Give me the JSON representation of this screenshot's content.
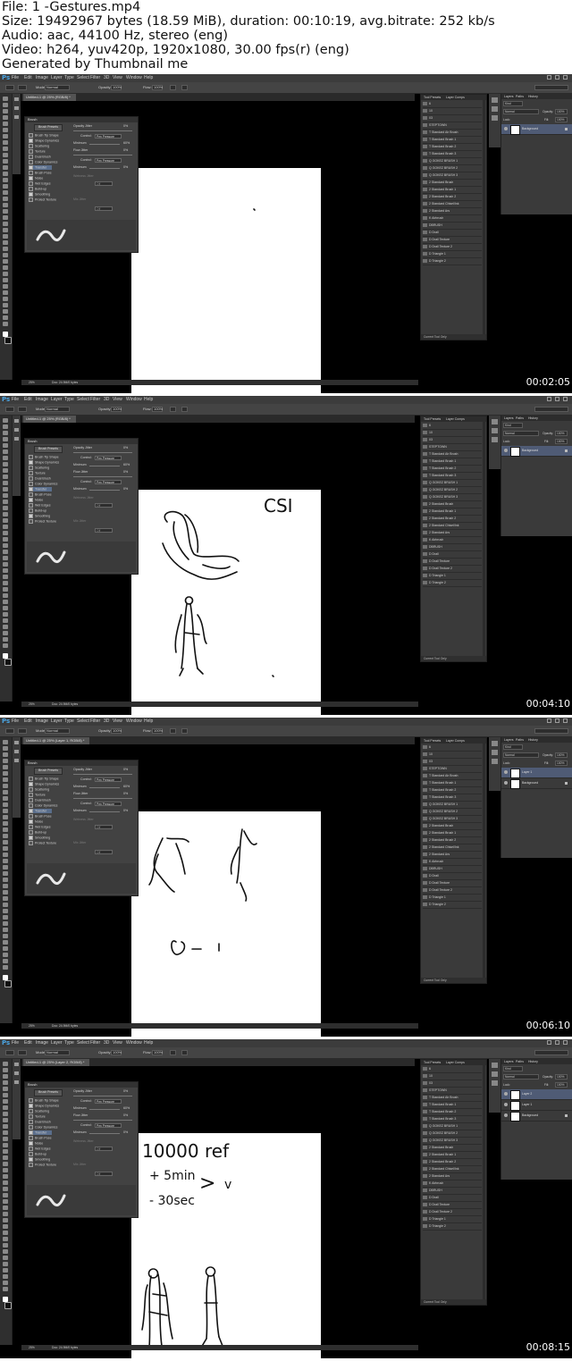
{
  "header": {
    "file_line": "File: 1 -Gestures.mp4",
    "size_line": "Size: 19492967 bytes (18.59 MiB), duration: 00:10:19, avg.bitrate: 252 kb/s",
    "audio_line": "Audio: aac, 44100 Hz, stereo (eng)",
    "video_line": "Video: h264, yuv420p, 1920x1080, 30.00 fps(r) (eng)",
    "generated_line": "Generated by Thumbnail me"
  },
  "app": {
    "logo": "Ps",
    "menu": [
      "File",
      "Edit",
      "Image",
      "Layer",
      "Type",
      "Select",
      "Filter",
      "3D",
      "View",
      "Window",
      "Help"
    ],
    "options_bar": {
      "mode_label": "Mode:",
      "mode_value": "Normal",
      "opacity_label": "Opacity:",
      "opacity_value": "100%",
      "flow_label": "Flow:",
      "flow_value": "100%"
    },
    "brush_panel": {
      "title": "Brush",
      "presets_button": "Brush Presets",
      "items": [
        {
          "label": "Brush Tip Shape",
          "checked": false,
          "active": false
        },
        {
          "label": "Shape Dynamics",
          "checked": true,
          "active": false
        },
        {
          "label": "Scattering",
          "checked": false,
          "active": false
        },
        {
          "label": "Texture",
          "checked": false,
          "active": false
        },
        {
          "label": "Dual Brush",
          "checked": false,
          "active": false
        },
        {
          "label": "Color Dynamics",
          "checked": false,
          "active": false
        },
        {
          "label": "Transfer",
          "checked": true,
          "active": true
        },
        {
          "label": "Brush Pose",
          "checked": false,
          "active": false
        },
        {
          "label": "Noise",
          "checked": true,
          "active": false
        },
        {
          "label": "Wet Edges",
          "checked": false,
          "active": false
        },
        {
          "label": "Build-up",
          "checked": false,
          "active": false
        },
        {
          "label": "Smoothing",
          "checked": true,
          "active": false
        },
        {
          "label": "Protect Texture",
          "checked": false,
          "active": false
        }
      ],
      "opacity_jitter_label": "Opacity Jitter",
      "opacity_jitter_value": "0%",
      "control_label": "Control:",
      "control_value": "Pen Pressure",
      "minimum_label": "Minimum",
      "minimum_value": "60%",
      "flow_jitter_label": "Flow Jitter",
      "flow_jitter_value": "0%",
      "control2_label": "Control:",
      "control2_value": "Pen Pressure",
      "minimum2_label": "Minimum",
      "minimum2_value": "0%",
      "wetness_label": "Wetness Jitter",
      "off_value": "Off",
      "mix_label": "Mix Jitter"
    },
    "presets_panel": {
      "tabs": [
        "Tool Presets",
        "Layer Comps"
      ],
      "items": [
        "6",
        "10",
        "03",
        "STEPTOWN",
        "T Standard Air Brush",
        "T Standard Brush 1",
        "T Standard Brush 2",
        "T Standard Brush 3",
        "Q GOKEZ BRUSH 1",
        "Q GOKEZ BRUSH 2",
        "Q GOKEZ BRUSH 3",
        "2 Standard Brush",
        "2 Standard Brush 1",
        "2 Standard Brush 2",
        "2 Standard Chisel/Ink",
        "2 Standard Ars",
        "K Airbrush",
        "DBRUSH",
        "D Drall",
        "D Drall Texture",
        "D Drall Texture 2",
        "D Triangle 1",
        "D Triangle 2"
      ],
      "footer": "Current Tool Only"
    },
    "layers_panel": {
      "tabs": [
        "Layers",
        "Paths",
        "History"
      ],
      "kind_value": "Kind",
      "blend_value": "Normal",
      "opacity_label": "Opacity:",
      "opacity_value": "100%",
      "lock_label": "Lock:",
      "fill_label": "Fill:",
      "fill_value": "100%"
    },
    "doc_tab_title": "Untitled-1 @ 25% (RGB/8) *",
    "status_zoom": "25%",
    "status_doc": "Doc: 24.9M/0 bytes"
  },
  "frames": [
    {
      "timestamp": "00:02:05",
      "layers": [
        {
          "name": "Background",
          "selected": true,
          "locked": true
        }
      ]
    },
    {
      "timestamp": "00:04:10",
      "canvas_text": "CSI",
      "layers": [
        {
          "name": "Background",
          "selected": true,
          "locked": true
        }
      ]
    },
    {
      "timestamp": "00:06:10",
      "doc_tab_title": "Untitled-1 @ 25% (Layer 1, RGB/8) *",
      "layers": [
        {
          "name": "Layer 1",
          "selected": true,
          "locked": false
        },
        {
          "name": "Background",
          "selected": false,
          "locked": true
        }
      ]
    },
    {
      "timestamp": "00:08:15",
      "doc_tab_title": "Untitled-1 @ 25% (Layer 2, RGB/8) *",
      "canvas_notes": [
        "10000 ref",
        "+ 5min",
        "- 30sec",
        ">",
        "v"
      ],
      "layers": [
        {
          "name": "Layer 2",
          "selected": true,
          "locked": false
        },
        {
          "name": "Layer 1",
          "selected": false,
          "locked": false
        },
        {
          "name": "Background",
          "selected": false,
          "locked": true
        }
      ]
    }
  ],
  "colors": {
    "ps_blue": "#4aa3e0",
    "panel_bg": "#424242",
    "selected_layer": "#4f5b75",
    "active_brush_item": "#5a6e8c"
  }
}
